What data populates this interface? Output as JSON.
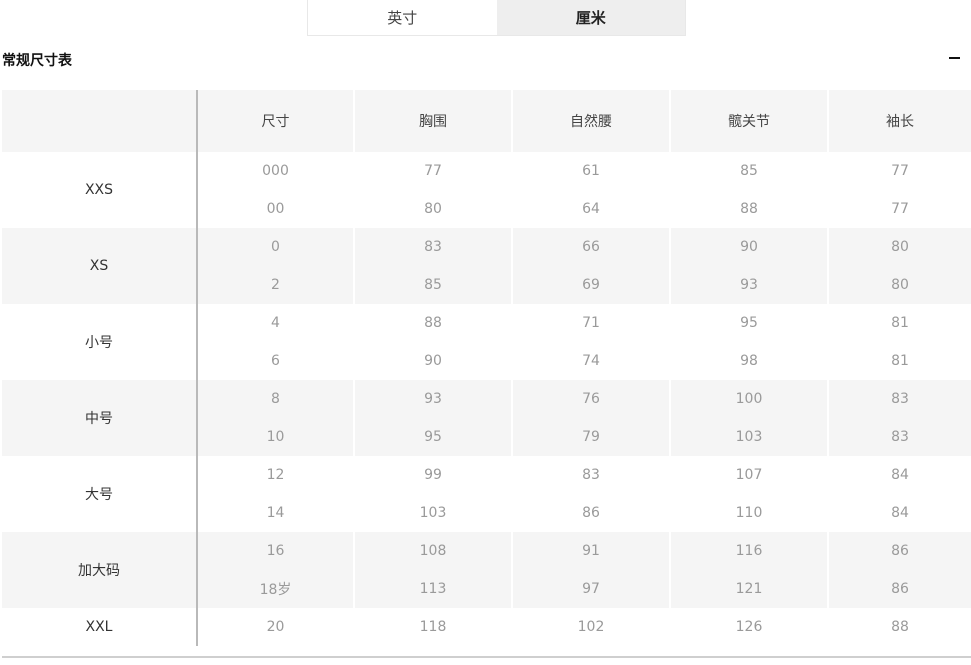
{
  "unit_toggle": {
    "inches": "英寸",
    "cm": "厘米",
    "selected": "cm"
  },
  "section": {
    "title": "常规尺寸表",
    "collapse_symbol": "−"
  },
  "table": {
    "headers": [
      "",
      "尺寸",
      "胸围",
      "自然腰",
      "髋关节",
      "袖长"
    ],
    "groups": [
      {
        "name": "XXS",
        "rows": [
          [
            "000",
            "77",
            "61",
            "85",
            "77"
          ],
          [
            "00",
            "80",
            "64",
            "88",
            "77"
          ]
        ]
      },
      {
        "name": "XS",
        "rows": [
          [
            "0",
            "83",
            "66",
            "90",
            "80"
          ],
          [
            "2",
            "85",
            "69",
            "93",
            "80"
          ]
        ]
      },
      {
        "name": "小号",
        "rows": [
          [
            "4",
            "88",
            "71",
            "95",
            "81"
          ],
          [
            "6",
            "90",
            "74",
            "98",
            "81"
          ]
        ]
      },
      {
        "name": "中号",
        "rows": [
          [
            "8",
            "93",
            "76",
            "100",
            "83"
          ],
          [
            "10",
            "95",
            "79",
            "103",
            "83"
          ]
        ]
      },
      {
        "name": "大号",
        "rows": [
          [
            "12",
            "99",
            "83",
            "107",
            "84"
          ],
          [
            "14",
            "103",
            "86",
            "110",
            "84"
          ]
        ]
      },
      {
        "name": "加大码",
        "rows": [
          [
            "16",
            "108",
            "91",
            "116",
            "86"
          ],
          [
            "18岁",
            "113",
            "97",
            "121",
            "86"
          ]
        ]
      },
      {
        "name": "XXL",
        "rows": [
          [
            "20",
            "118",
            "102",
            "126",
            "88"
          ]
        ]
      }
    ]
  }
}
